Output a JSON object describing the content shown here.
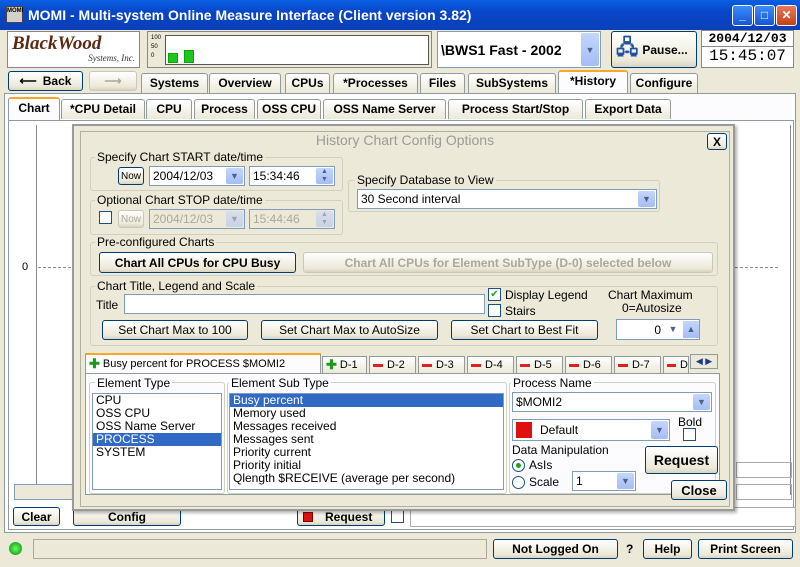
{
  "window": {
    "title": "MOMI - Multi-system Online Measure Interface (Client version 3.82)"
  },
  "logo": {
    "line1": "BlackWood",
    "line2": "Systems, Inc."
  },
  "header": {
    "system": "\\BWS1 Fast - 2002",
    "pause": "Pause...",
    "date": "2004/12/03",
    "time": "15:45:07",
    "back": "Back",
    "spark_ticks": [
      "100",
      "50",
      "0"
    ]
  },
  "main_tabs": [
    "Systems",
    "Overview",
    "CPUs",
    "*Processes",
    "Files",
    "SubSystems",
    "*History",
    "Configure"
  ],
  "sub_tabs": [
    "Chart",
    "*CPU Detail",
    "CPU",
    "Process",
    "OSS CPU",
    "OSS Name Server",
    "Process Start/Stop",
    "Export Data"
  ],
  "chart": {
    "y_zero": "0"
  },
  "bottom": {
    "clear": "Clear",
    "config": "Config",
    "request": "Request",
    "not_logged": "Not Logged On",
    "help_q": "?",
    "help": "Help",
    "print": "Print Screen"
  },
  "dialog": {
    "title": "History Chart Config Options",
    "close_x": "X",
    "start": {
      "label": "Specify Chart START date/time",
      "now": "Now",
      "date": "2004/12/03",
      "time": "15:34:46"
    },
    "stop": {
      "label": "Optional Chart STOP date/time",
      "now": "Now",
      "date": "2004/12/03",
      "time": "15:44:46"
    },
    "database": {
      "label": "Specify Database to View",
      "value": "30 Second interval"
    },
    "preconf": {
      "label": "Pre-configured Charts",
      "btn1": "Chart All CPUs for CPU Busy",
      "btn2": "Chart All CPUs for Element SubType (D-0) selected below"
    },
    "titlegrp": {
      "label": "Chart Title, Legend and Scale",
      "title_label": "Title",
      "title_value": "",
      "display_legend": "Display Legend",
      "stairs": "Stairs",
      "chart_max": "Chart Maximum",
      "autosize_hint": "0=Autosize",
      "max_value": "0",
      "btn_max100": "Set Chart Max to 100",
      "btn_auto": "Set Chart Max to AutoSize",
      "btn_fit": "Set Chart to Best Fit"
    },
    "dtabs": [
      "Busy percent for PROCESS $MOMI2",
      "D-1",
      "D-2",
      "D-3",
      "D-4",
      "D-5",
      "D-6",
      "D-7",
      "D"
    ],
    "element_type": {
      "label": "Element Type",
      "items": [
        "CPU",
        "OSS CPU",
        "OSS Name Server",
        "PROCESS",
        "SYSTEM"
      ],
      "selected": 3
    },
    "element_subtype": {
      "label": "Element Sub Type",
      "items": [
        "Busy percent",
        "Memory used",
        "Messages received",
        "Messages sent",
        "Priority current",
        "Priority initial",
        "Qlength $RECEIVE (average per second)"
      ],
      "selected": 0
    },
    "process": {
      "label": "Process Name",
      "value": "$MOMI2",
      "color": "Default",
      "color_hex": "#e01010",
      "bold": "Bold"
    },
    "manip": {
      "label": "Data Manipulation",
      "asis": "AsIs",
      "scale": "Scale",
      "scale_value": "1"
    },
    "request": "Request",
    "close": "Close"
  },
  "colors": {
    "accent": "#0a5fe3",
    "tab_highlight": "#f8a828",
    "selection": "#316ac5",
    "spark_bar": "#22c422"
  }
}
